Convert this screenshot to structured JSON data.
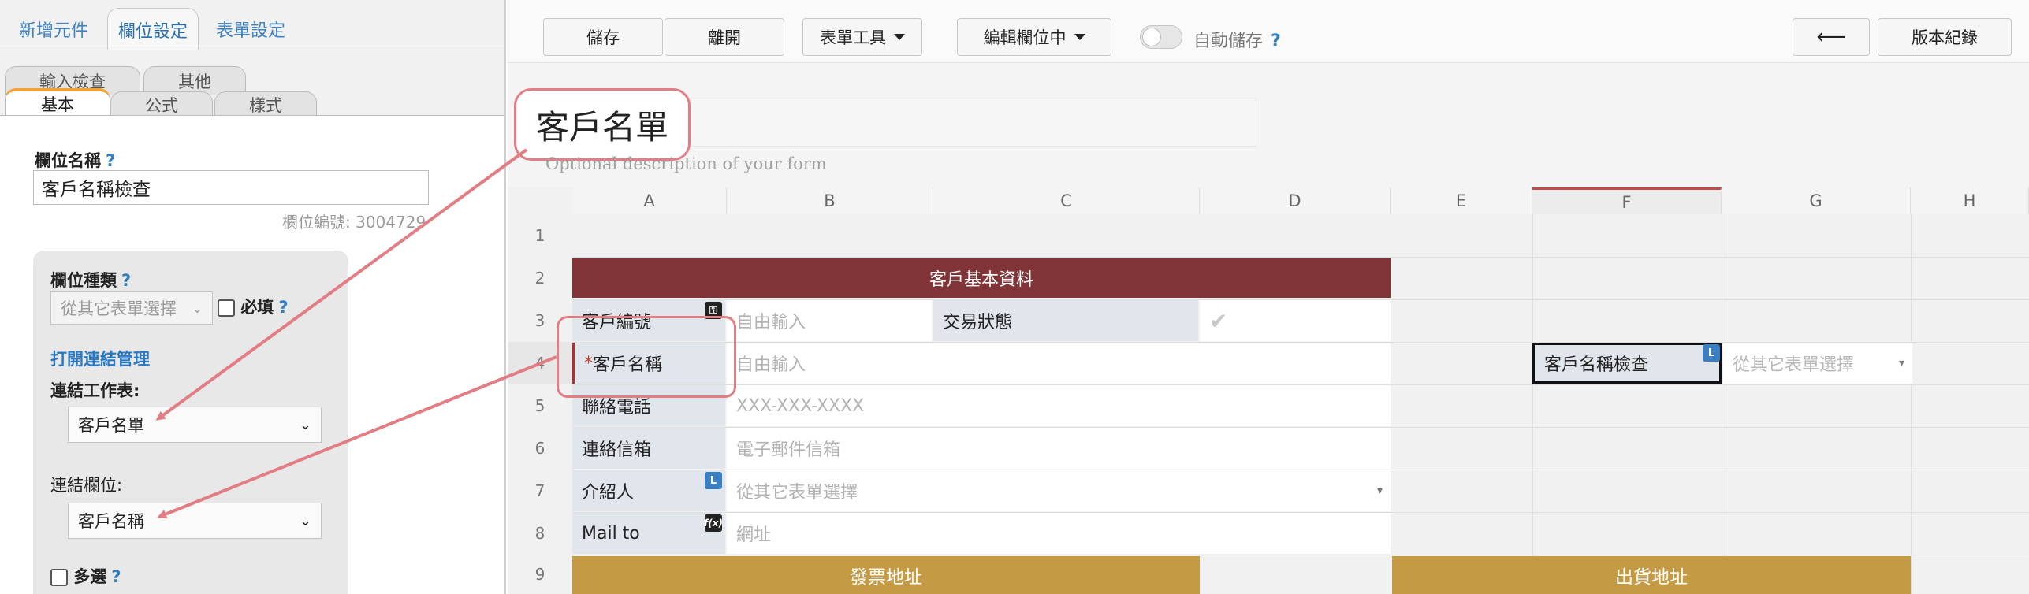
{
  "left_panel": {
    "top_tabs": [
      "新增元件",
      "欄位設定",
      "表單設定"
    ],
    "sub_tabs_row1": [
      "輸入檢查",
      "其他"
    ],
    "sub_tabs_row2": [
      "基本",
      "公式",
      "樣式"
    ],
    "field_name_label": "欄位名稱",
    "help": "?",
    "field_name_value": "客戶名稱檢查",
    "field_id": "欄位編號: 3004729",
    "field_type_label": "欄位種類",
    "field_type_value": "從其它表單選擇",
    "required_label": "必填",
    "open_link_manager": "打開連結管理",
    "link_sheet_label": "連結工作表:",
    "link_sheet_value": "客戶名單",
    "link_field_label": "連結欄位:",
    "link_field_value": "客戶名稱",
    "multi_label": "多選"
  },
  "toolbar": {
    "save": "儲存",
    "leave": "離開",
    "form_tools": "表單工具",
    "edit_field": "編輯欄位中",
    "autosave": "自動儲存",
    "autosave_help": "?",
    "back_arrow": "⟵",
    "version": "版本紀錄"
  },
  "form": {
    "title": "客戶名單",
    "description": "Optional description of your form"
  },
  "grid": {
    "columns": [
      "A",
      "B",
      "C",
      "D",
      "E",
      "F",
      "G",
      "H"
    ],
    "rows": [
      "1",
      "2",
      "3",
      "4",
      "5",
      "6",
      "7",
      "8",
      "9"
    ],
    "section_header": "客戶基本資料",
    "customer_id": "客戶編號",
    "free_input": "自由輸入",
    "trade_status": "交易狀態",
    "required_mark": "*",
    "customer_name": "客戶名稱",
    "phone": "聯絡電話",
    "phone_placeholder": "XXX-XXX-XXXX",
    "email": "連絡信箱",
    "email_placeholder": "電子郵件信箱",
    "referrer": "介紹人",
    "select_placeholder": "從其它表單選擇",
    "mail_to": "Mail to",
    "url_placeholder": "網址",
    "invoice_address": "發票地址",
    "shipping_address": "出貨地址",
    "check_field": "客戶名稱檢查",
    "badge_L": "L",
    "badge_f": "f(x)"
  },
  "colors": {
    "header_red": "#813437",
    "header_gold": "#c49a45",
    "annotation": "#e27d84",
    "accent_blue": "#2b78c2"
  }
}
